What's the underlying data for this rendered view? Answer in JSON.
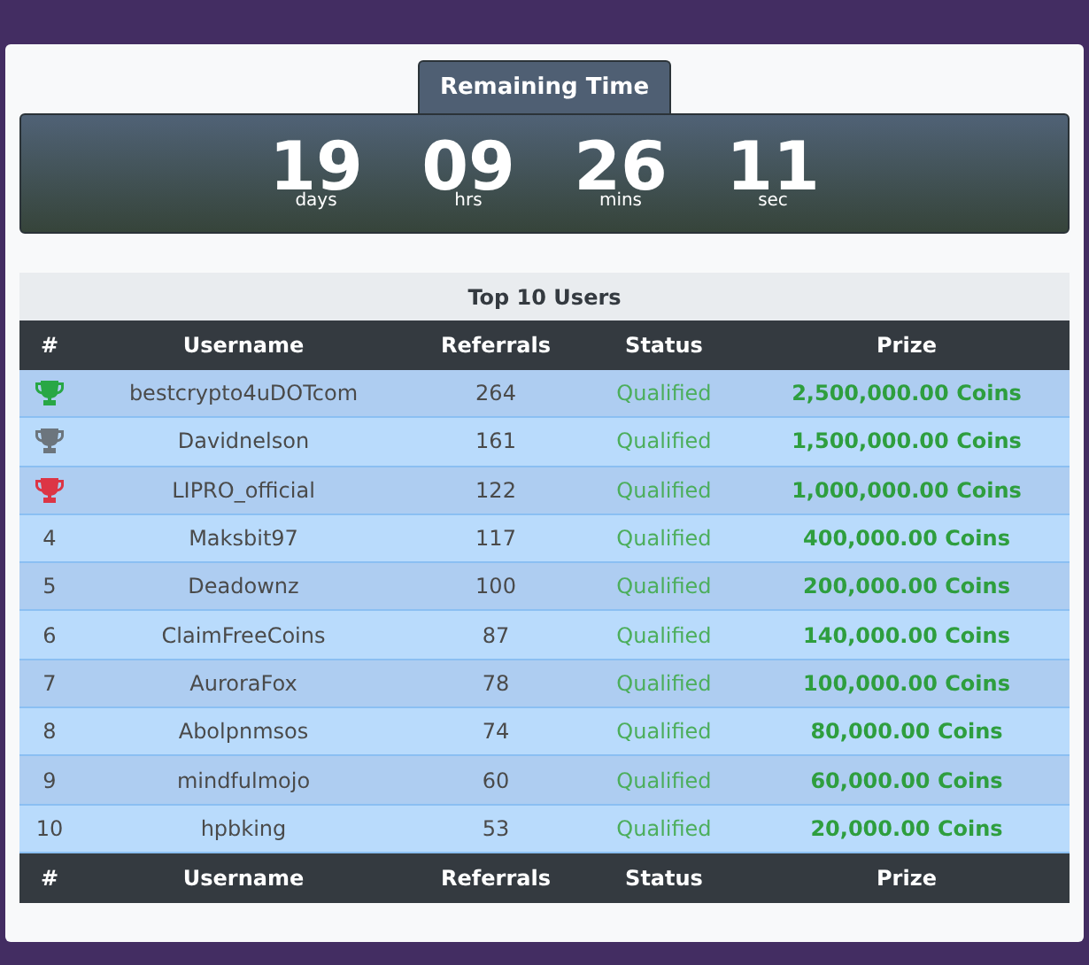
{
  "timer": {
    "tab_label": "Remaining Time",
    "units": [
      {
        "value": "19",
        "label": "days"
      },
      {
        "value": "09",
        "label": "hrs"
      },
      {
        "value": "26",
        "label": "mins"
      },
      {
        "value": "11",
        "label": "sec"
      }
    ]
  },
  "table": {
    "title": "Top 10 Users",
    "columns": [
      "#",
      "Username",
      "Referrals",
      "Status",
      "Prize"
    ],
    "rows": [
      {
        "kind": "trophy",
        "color": "#28a745",
        "username": "bestcrypto4uDOTcom",
        "referrals": "264",
        "status": "Qualified",
        "prize": "2,500,000.00 Coins"
      },
      {
        "kind": "trophy",
        "color": "#6c757d",
        "username": "Davidnelson",
        "referrals": "161",
        "status": "Qualified",
        "prize": "1,500,000.00 Coins"
      },
      {
        "kind": "trophy",
        "color": "#dc3545",
        "username": "LIPRO_official",
        "referrals": "122",
        "status": "Qualified",
        "prize": "1,000,000.00 Coins"
      },
      {
        "kind": "number",
        "rank": "4",
        "username": "Maksbit97",
        "referrals": "117",
        "status": "Qualified",
        "prize": "400,000.00 Coins"
      },
      {
        "kind": "number",
        "rank": "5",
        "username": "Deadownz",
        "referrals": "100",
        "status": "Qualified",
        "prize": "200,000.00 Coins"
      },
      {
        "kind": "number",
        "rank": "6",
        "username": "ClaimFreeCoins",
        "referrals": "87",
        "status": "Qualified",
        "prize": "140,000.00 Coins"
      },
      {
        "kind": "number",
        "rank": "7",
        "username": "AuroraFox",
        "referrals": "78",
        "status": "Qualified",
        "prize": "100,000.00 Coins"
      },
      {
        "kind": "number",
        "rank": "8",
        "username": "Abolpnmsos",
        "referrals": "74",
        "status": "Qualified",
        "prize": "80,000.00 Coins"
      },
      {
        "kind": "number",
        "rank": "9",
        "username": "mindfulmojo",
        "referrals": "60",
        "status": "Qualified",
        "prize": "60,000.00 Coins"
      },
      {
        "kind": "number",
        "rank": "10",
        "username": "hpbking",
        "referrals": "53",
        "status": "Qualified",
        "prize": "20,000.00 Coins"
      }
    ],
    "footer_columns": [
      "#",
      "Username",
      "Referrals",
      "Status",
      "Prize"
    ]
  }
}
